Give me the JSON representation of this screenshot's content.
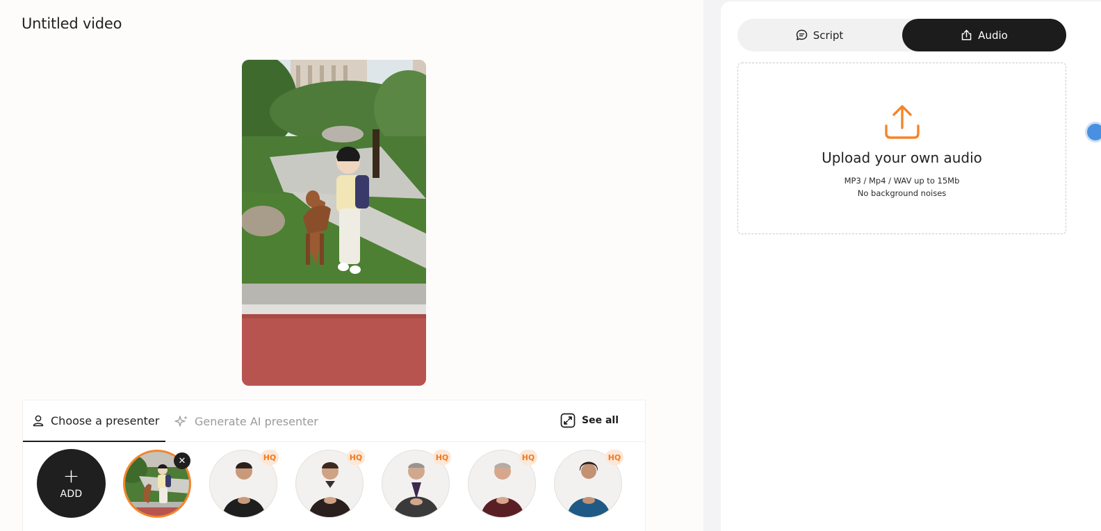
{
  "page": {
    "title": "Untitled video"
  },
  "presenter_tabs": {
    "choose": "Choose a presenter",
    "generate": "Generate AI presenter",
    "see_all": "See all"
  },
  "presenters": {
    "add_label": "ADD",
    "hq_badge": "HQ",
    "remove_symbol": "✕",
    "items": [
      {
        "kind": "uploaded-photo",
        "selected": true
      },
      {
        "kind": "man-black-tshirt",
        "hq": true,
        "shirt": "#1e1e1e"
      },
      {
        "kind": "man-black-polo",
        "hq": true,
        "shirt": "#2a211e"
      },
      {
        "kind": "older-man-suit",
        "hq": true,
        "shirt": "#3a3a3a"
      },
      {
        "kind": "older-man-maroon-tshirt",
        "hq": true,
        "shirt": "#5a1f24"
      },
      {
        "kind": "woman-blue-blouse",
        "hq": true,
        "shirt": "#1f5a86"
      }
    ]
  },
  "input_mode": {
    "script_label": "Script",
    "audio_label": "Audio",
    "active": "audio"
  },
  "upload": {
    "title": "Upload your own audio",
    "formats": "MP3 / Mp4 / WAV up to 15Mb",
    "note": "No background noises"
  },
  "colors": {
    "accent": "#f5852a",
    "dark": "#1c1c1c",
    "hq_bg": "#fde7d6",
    "hq_text": "#f27a21"
  },
  "icons": {
    "choose_tab": "person-icon",
    "generate_tab": "sparkles-icon",
    "see_all": "expand-icon",
    "script": "chat-bubble-icon",
    "audio": "upload-icon",
    "dropzone": "upload-arrow-icon"
  }
}
